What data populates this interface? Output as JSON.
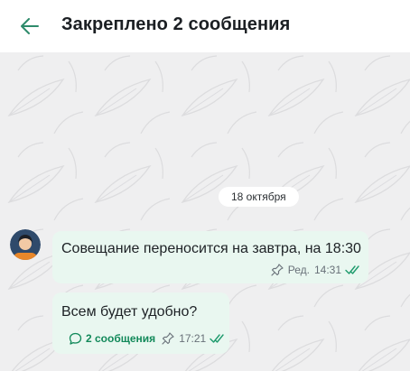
{
  "header": {
    "title": "Закреплено 2 сообщения",
    "back_icon": "arrow-left-icon",
    "accent": "#2e8b6b"
  },
  "chat": {
    "date_separator": "18 октября",
    "messages": [
      {
        "text": "Совещание переносится на завтра, на 18:30",
        "edited": "Ред.",
        "time": "14:31",
        "pinned": true,
        "status": "read"
      },
      {
        "text": "Всем будет удобно?",
        "thread_label": "2 сообщения",
        "time": "17:21",
        "pinned": true,
        "status": "read"
      }
    ]
  },
  "colors": {
    "bubble": "#e9f7f0",
    "read_checks": "#1d9a6c",
    "background": "#efeff0"
  }
}
